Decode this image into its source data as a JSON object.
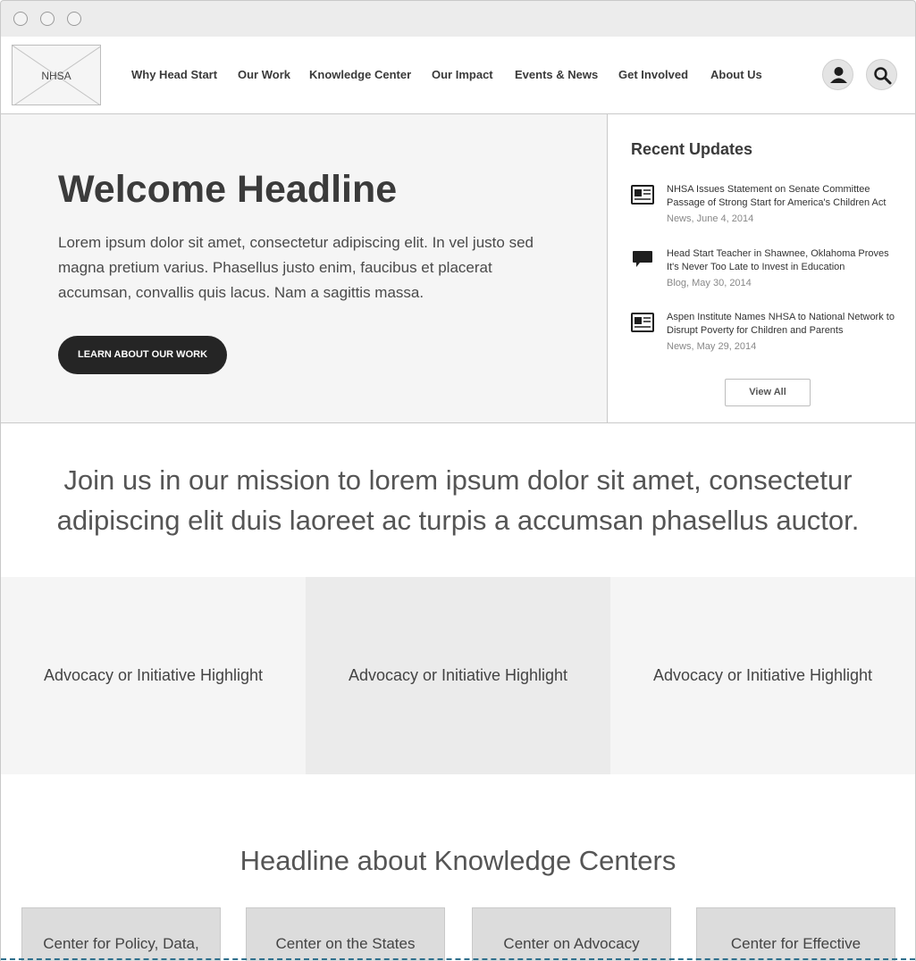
{
  "logo": {
    "text": "NHSA"
  },
  "nav": [
    "Why Head Start",
    "Our Work",
    "Knowledge Center",
    "Our Impact",
    "Events & News",
    "Get Involved",
    "About Us"
  ],
  "header_icons": [
    "user-icon",
    "search-icon"
  ],
  "hero": {
    "headline": "Welcome Headline",
    "body": "Lorem ipsum dolor sit amet, consectetur adipiscing elit. In vel justo sed magna pretium varius. Phasellus justo enim, faucibus et placerat accumsan, convallis quis lacus. Nam a sagittis massa.",
    "cta": "LEARN ABOUT OUR WORK"
  },
  "updates": {
    "title": "Recent Updates",
    "items": [
      {
        "icon": "newspaper-icon",
        "title": "NHSA Issues Statement on Senate Committee Passage of Strong Start for America's Children Act",
        "meta": "News, June 4, 2014"
      },
      {
        "icon": "speech-bubble-icon",
        "title": "Head Start Teacher in Shawnee, Oklahoma Proves It's Never Too Late to Invest in Education",
        "meta": "Blog, May 30, 2014"
      },
      {
        "icon": "newspaper-icon",
        "title": "Aspen Institute Names NHSA to National Network to Disrupt Poverty for Children and Parents",
        "meta": "News, May 29, 2014"
      }
    ],
    "view_all": "View All"
  },
  "mission": "Join us in our mission to lorem ipsum dolor sit amet, consectetur adipiscing elit duis laoreet ac turpis a accumsan phasellus auctor.",
  "highlights": [
    "Advocacy or Initiative Highlight",
    "Advocacy or Initiative Highlight",
    "Advocacy or Initiative Highlight"
  ],
  "knowledge": {
    "headline": "Headline about Knowledge Centers",
    "cards": [
      "Center for Policy, Data,",
      "Center on the States",
      "Center on Advocacy",
      "Center for Effective"
    ]
  },
  "colors": {
    "hero_bg": "#f5f5f5",
    "cta_bg": "#252525",
    "highlight_light": "#f5f5f5",
    "highlight_mid": "#ebebeb",
    "card_bg": "#dcdcdc",
    "fold_line": "#2f6f8c"
  }
}
